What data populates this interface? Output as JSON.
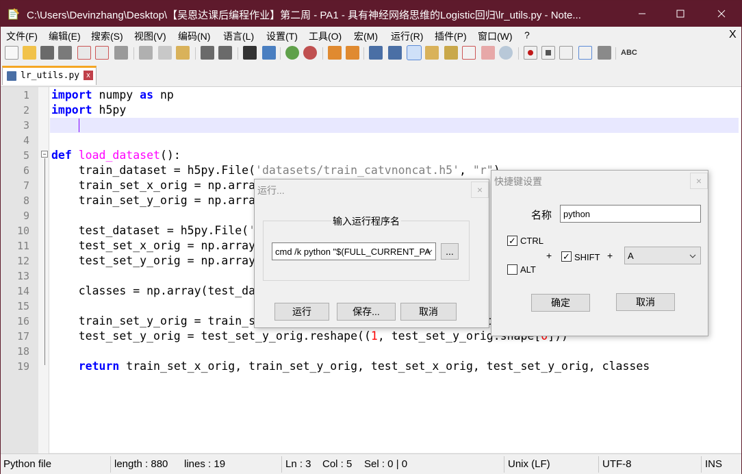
{
  "window": {
    "title": "C:\\Users\\Devinzhang\\Desktop\\【吴恩达课后编程作业】第二周 - PA1 - 具有神经网络思维的Logistic回归\\lr_utils.py - Note...",
    "colors": {
      "titlebar": "#5e1a2c",
      "keyword": "#0000ff",
      "function": "#ff00ff",
      "string": "#808080",
      "number": "#ff0000"
    }
  },
  "menu": {
    "items": [
      "文件(F)",
      "编辑(E)",
      "搜索(S)",
      "视图(V)",
      "编码(N)",
      "语言(L)",
      "设置(T)",
      "工具(O)",
      "宏(M)",
      "运行(R)",
      "插件(P)",
      "窗口(W)",
      "?"
    ],
    "close": "X"
  },
  "tab": {
    "label": "lr_utils.py",
    "close": "x"
  },
  "editor": {
    "line_numbers": [
      "1",
      "2",
      "3",
      "4",
      "5",
      "6",
      "7",
      "8",
      "9",
      "10",
      "11",
      "12",
      "13",
      "14",
      "15",
      "16",
      "17",
      "18",
      "19"
    ],
    "current_line": 3
  },
  "status": {
    "file_type": "Python file",
    "length": "length : 880",
    "lines": "lines : 19",
    "ln": "Ln : 3",
    "col": "Col : 5",
    "sel": "Sel : 0 | 0",
    "eol": "Unix (LF)",
    "encoding": "UTF-8",
    "mode": "INS"
  },
  "run_dialog": {
    "title": "运行...",
    "group_label": "输入运行程序名",
    "command_value": "cmd /k python \"$(FULL_CURRENT_PA",
    "browse_label": "...",
    "run_label": "运行",
    "save_label": "保存...",
    "cancel_label": "取消"
  },
  "shortcut_dialog": {
    "title": "快捷键设置",
    "name_label": "名称",
    "name_value": "python",
    "ctrl_label": "CTRL",
    "ctrl_checked": true,
    "alt_label": "ALT",
    "alt_checked": false,
    "shift_label": "SHIFT",
    "shift_checked": true,
    "plus1": "+",
    "plus2": "+",
    "key_value": "A",
    "ok_label": "确定",
    "cancel_label": "取消"
  }
}
